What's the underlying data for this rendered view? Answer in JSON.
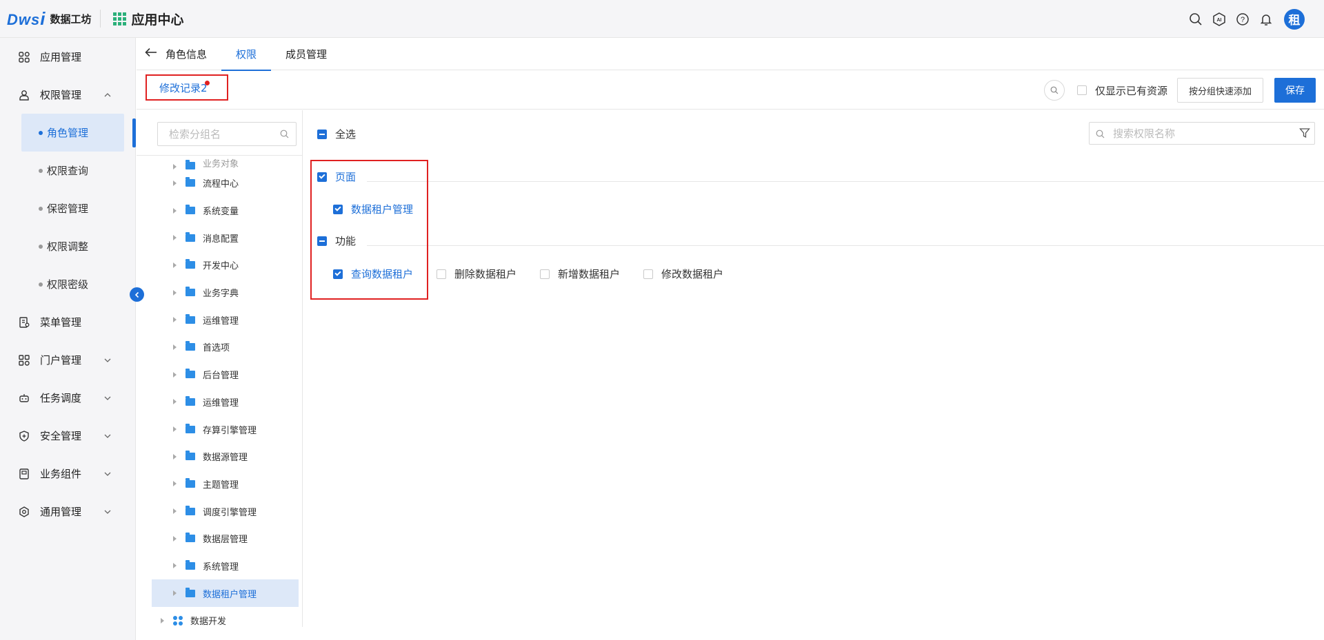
{
  "app": {
    "logo_text": "Dws",
    "logo_i": "i",
    "brand": "数据工坊",
    "center_title": "应用中心",
    "avatar_text": "租",
    "top_icons": [
      "search-icon",
      "ai-icon",
      "help-icon",
      "bell-icon"
    ]
  },
  "sidebar": {
    "items": [
      {
        "label": "应用管理",
        "icon": "apps-icon"
      },
      {
        "label": "权限管理",
        "icon": "user-lock-icon",
        "expanded": true
      },
      {
        "label": "菜单管理",
        "icon": "menu-doc-icon"
      },
      {
        "label": "门户管理",
        "icon": "portal-icon"
      },
      {
        "label": "任务调度",
        "icon": "robot-icon"
      },
      {
        "label": "安全管理",
        "icon": "shield-icon"
      },
      {
        "label": "业务组件",
        "icon": "component-icon"
      },
      {
        "label": "通用管理",
        "icon": "settings-icon"
      }
    ],
    "sub_items": [
      {
        "label": "角色管理",
        "active": true
      },
      {
        "label": "权限查询"
      },
      {
        "label": "保密管理"
      },
      {
        "label": "权限调整"
      },
      {
        "label": "权限密级"
      }
    ]
  },
  "tabs": [
    {
      "label": "角色信息"
    },
    {
      "label": "权限",
      "active": true
    },
    {
      "label": "成员管理"
    }
  ],
  "toolbar": {
    "mod_record": "修改记录2",
    "only_existing_label": "仅显示已有资源",
    "quick_add_label": "按分组快速添加",
    "save_label": "保存"
  },
  "tree": {
    "search_placeholder": "检索分组名",
    "partial_top": "业务对象",
    "rows": [
      "流程中心",
      "系统变量",
      "消息配置",
      "开发中心",
      "业务字典",
      "运维管理",
      "首选项",
      "后台管理",
      "运维管理",
      "存算引擎管理",
      "数据源管理",
      "主题管理",
      "调度引擎管理",
      "数据层管理",
      "系统管理",
      "数据租户管理"
    ],
    "selected": "数据租户管理",
    "group": "数据开发"
  },
  "content": {
    "select_all_label": "全选",
    "search_placeholder": "搜索权限名称",
    "sections": {
      "page": {
        "label": "页面",
        "items": [
          {
            "label": "数据租户管理",
            "checked": true
          }
        ]
      },
      "func": {
        "label": "功能",
        "items": [
          {
            "label": "查询数据租户",
            "checked": true
          },
          {
            "label": "删除数据租户",
            "checked": false
          },
          {
            "label": "新增数据租户",
            "checked": false
          },
          {
            "label": "修改数据租户",
            "checked": false
          }
        ]
      }
    }
  },
  "colors": {
    "primary": "#1d6fd8",
    "highlight_border": "#e02020",
    "selected_bg": "#dde8f8"
  }
}
